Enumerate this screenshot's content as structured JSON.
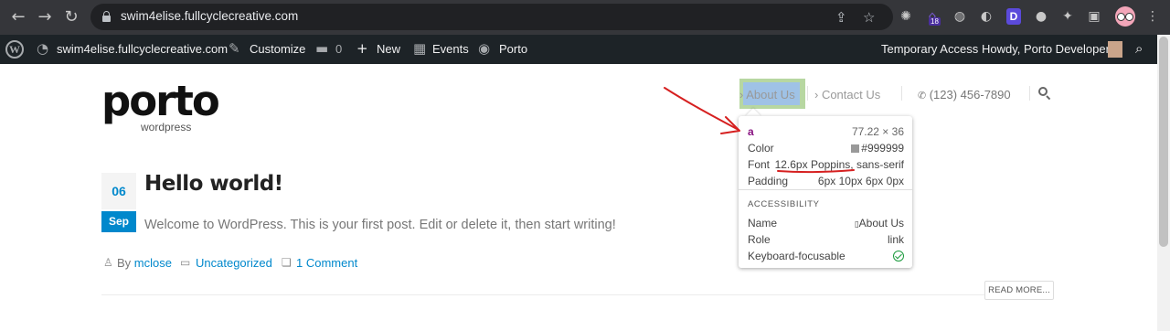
{
  "browser": {
    "url": "swim4elise.fullcyclecreative.com",
    "extension_badge": "18",
    "extension_letter": "D"
  },
  "adminbar": {
    "site_name": "swim4elise.fullcyclecreative.com",
    "customize": "Customize",
    "comments_count": "0",
    "new": "New",
    "events": "Events",
    "porto": "Porto",
    "temporary_access": "Temporary Access",
    "howdy": "Howdy, Porto Developer"
  },
  "site": {
    "logo": "porto",
    "logo_sub": "wordpress",
    "nav": {
      "about": "› About Us",
      "contact": "› Contact Us",
      "phone": "(123) 456-7890"
    }
  },
  "tooltip": {
    "tag": "a",
    "dims": "77.22 × 36",
    "color_label": "Color",
    "color_value": "#999999",
    "font_label": "Font",
    "font_value": "12.6px Poppins, sans-serif",
    "padding_label": "Padding",
    "padding_value": "6px 10px 6px 0px",
    "section": "ACCESSIBILITY",
    "name_label": "Name",
    "name_value": "About Us",
    "role_label": "Role",
    "role_value": "link",
    "focus_label": "Keyboard-focusable"
  },
  "post": {
    "day": "06",
    "month": "Sep",
    "title": "Hello world!",
    "excerpt": "Welcome to WordPress. This is your first post. Edit or delete it, then start writing!",
    "by": "By",
    "author": "mclose",
    "category": "Uncategorized",
    "comments": "1 Comment",
    "read_more": "READ MORE..."
  },
  "colors": {
    "accent": "#0088cc",
    "annotation": "#d62020",
    "highlight_content": "#9fc2e6",
    "highlight_padding": "#b7d7a1"
  }
}
